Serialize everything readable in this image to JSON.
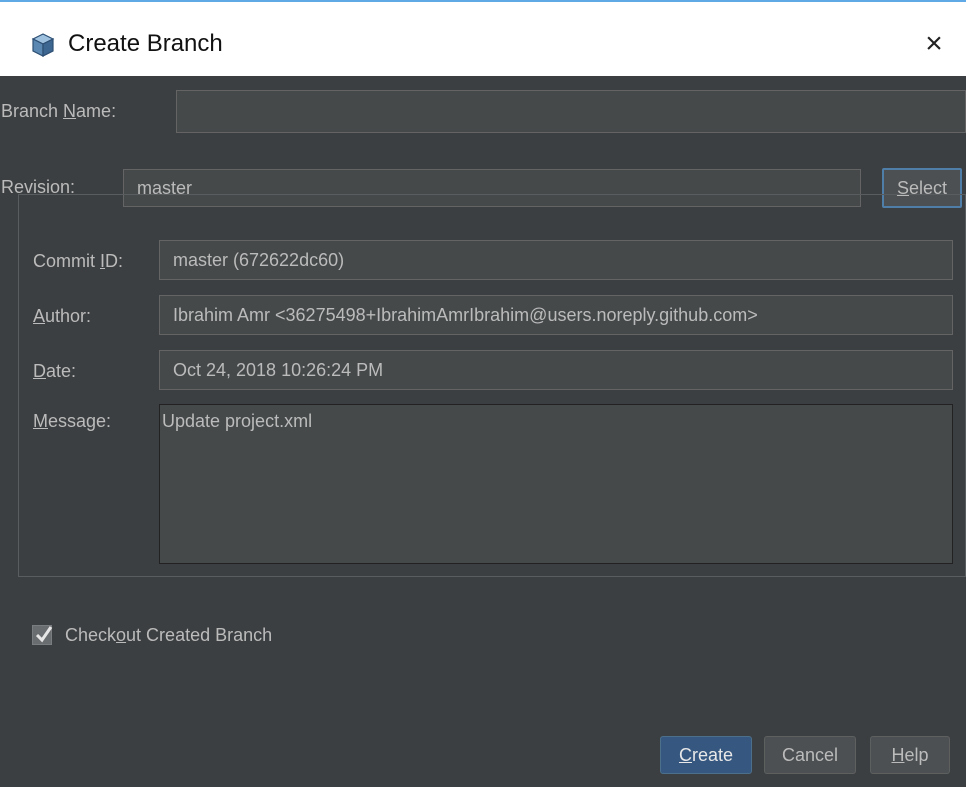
{
  "window": {
    "title": "Create Branch",
    "close_glyph": "×"
  },
  "form": {
    "branch_name": {
      "label_pre": "Branch ",
      "label_mnemonic": "N",
      "label_post": "ame:",
      "value": ""
    },
    "revision": {
      "label_pre": "Re",
      "label_mnemonic": "v",
      "label_post": "ision:",
      "value": "master"
    },
    "select_button": {
      "mnemonic": "S",
      "rest": "elect"
    }
  },
  "commit": {
    "commit_id": {
      "label_pre": "Commit ",
      "label_mnemonic": "I",
      "label_post": "D:",
      "value": "master (672622dc60)"
    },
    "author": {
      "label_pre": "",
      "label_mnemonic": "A",
      "label_post": "uthor:",
      "value": "Ibrahim Amr <36275498+IbrahimAmrIbrahim@users.noreply.github.com>"
    },
    "date": {
      "label_pre": "",
      "label_mnemonic": "D",
      "label_post": "ate:",
      "value": "Oct 24, 2018 10:26:24 PM"
    },
    "message": {
      "label_pre": "",
      "label_mnemonic": "M",
      "label_post": "essage:",
      "value": "Update project.xml"
    }
  },
  "checkout": {
    "checked": true,
    "label_pre": "Check",
    "label_mnemonic": "o",
    "label_post": "ut Created Branch"
  },
  "buttons": {
    "create": {
      "mnemonic": "C",
      "rest": "reate"
    },
    "cancel": {
      "label": "Cancel"
    },
    "help": {
      "mnemonic": "H",
      "rest": "elp"
    }
  },
  "icons": {
    "title_icon": "cube-icon",
    "close_icon": "close-icon",
    "checkbox_icon": "checkmark-icon"
  },
  "colors": {
    "dialog_bg": "#3c3f41",
    "field_bg": "#45494a",
    "primary_button": "#365880",
    "text": "#bbbbbb",
    "accent_line": "#5ea9e6"
  }
}
